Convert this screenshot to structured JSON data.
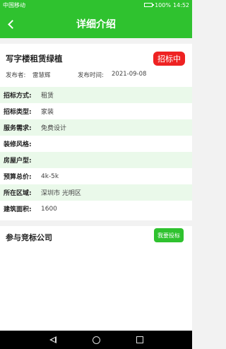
{
  "status_bar": {
    "carrier": "中国移动",
    "signal_icon": "signal-wifi-icon",
    "battery_text": "100%",
    "time": "14:52"
  },
  "header": {
    "title": "详细介绍",
    "back_icon": "back-arrow-icon"
  },
  "listing": {
    "title": "写字楼租赁绿植",
    "status_badge": "招标中",
    "publisher_label": "发布者:",
    "publisher_value": "雷慧辉",
    "time_label": "发布时间:",
    "time_value": "2021-09-08"
  },
  "details": [
    {
      "label": "招标方式:",
      "value": "租赁"
    },
    {
      "label": "招标类型:",
      "value": "家装"
    },
    {
      "label": "服务需求:",
      "value": "免费设计"
    },
    {
      "label": "装修风格:",
      "value": ""
    },
    {
      "label": "房屋户型:",
      "value": ""
    },
    {
      "label": "预算总价:",
      "value": "4k-5k"
    },
    {
      "label": "所在区域:",
      "value": "深圳市 光明区"
    },
    {
      "label": "建筑面积:",
      "value": "1600"
    }
  ],
  "bidders": {
    "title": "参与竞标公司",
    "bid_button": "我要投标"
  },
  "colors": {
    "brand": "#2fc22f",
    "badge": "#ee2222",
    "row_highlight": "#eaf9ea"
  }
}
